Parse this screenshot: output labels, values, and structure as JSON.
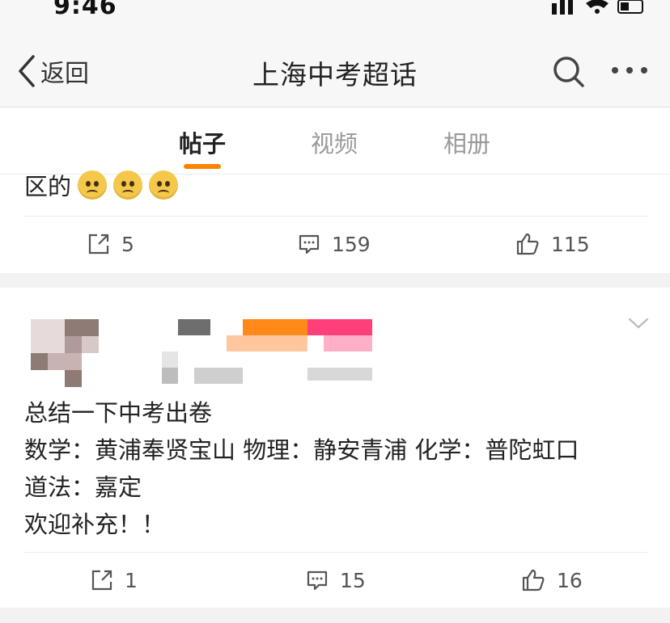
{
  "status_bar": {
    "time": "9:46"
  },
  "nav": {
    "back_label": "返回",
    "title": "上海中考超话"
  },
  "tabs": [
    {
      "label": "帖子",
      "active": true
    },
    {
      "label": "视频",
      "active": false
    },
    {
      "label": "相册",
      "active": false
    }
  ],
  "posts": [
    {
      "text_lines": [
        "区的"
      ],
      "emoji_count": 3,
      "emoji_name": "sad-face-emoji",
      "actions": {
        "share": "5",
        "comment": "159",
        "like": "115"
      }
    },
    {
      "text_lines": [
        "总结一下中考出卷",
        "数学：黄浦奉贤宝山 物理：静安青浦 化学：普陀虹口",
        "道法：嘉定",
        "欢迎补充！！"
      ],
      "actions": {
        "share": "1",
        "comment": "15",
        "like": "16"
      }
    }
  ],
  "colors": {
    "accent": "#ff8200",
    "gap": "#f2f2f2",
    "text": "#222222",
    "muted": "#999999"
  }
}
